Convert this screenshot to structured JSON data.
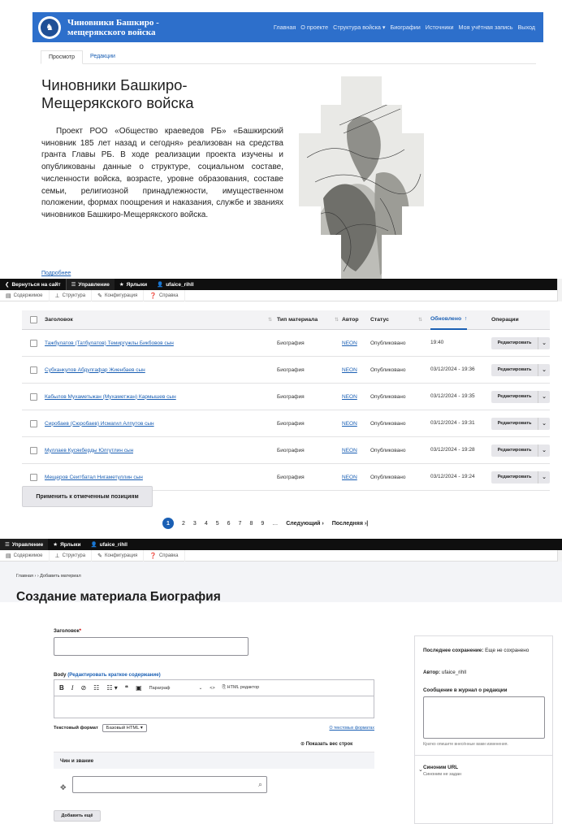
{
  "site": {
    "name": "Чиновники Башкиро - мещерякского войска",
    "nav": [
      "Главная",
      "О проекте",
      "Структура войска ▾",
      "Биографии",
      "Источники",
      "Моя учётная запись",
      "Выход"
    ],
    "tabs": {
      "view": "Просмотр",
      "edit": "Редакции"
    },
    "title": "Чиновники Башкиро-Мещерякского войска",
    "intro": "Проект РОО «Общество краеведов РБ» «Башкирский чиновник 185 лет назад и сегодня» реализован на средства гранта Главы РБ. В ходе реализации проекта изучены и опубликованы данные о структуре, социальном составе, численности войска, возрасте, уровне образования, составе семьи, религиозной принадлежности, имущественном положении, формах поощрения и наказания, службе и званиях чиновников Башкиро-Мещерякского войска.",
    "more": "Подробнее"
  },
  "admin_toolbar": {
    "back": "Вернуться на сайт",
    "manage": "Управление",
    "shortcuts": "Ярлыки",
    "user": "ufaice_rihll"
  },
  "admin_subbar": [
    "Содержимое",
    "Структура",
    "Конфигурация",
    "Справка"
  ],
  "content_table": {
    "headers": {
      "title": "Заголовок",
      "type": "Тип материала",
      "author": "Автор",
      "status": "Статус",
      "updated": "Обновлено",
      "ops": "Операции"
    },
    "rows": [
      {
        "title": "Тажбулатов (Татбулатов) Темиргужлы Бикбовов сын",
        "type": "Биография",
        "author": "NEON",
        "status": "Опубликовано",
        "updated": "19:40"
      },
      {
        "title": "Субханкулов Абдулгафар Жиенбаев сын",
        "type": "Биография",
        "author": "NEON",
        "status": "Опубликовано",
        "updated": "03/12/2024 - 19:36"
      },
      {
        "title": "Кабылов Мухаметьжан (Мухаметжан) Кармышев сын",
        "type": "Биография",
        "author": "NEON",
        "status": "Опубликовано",
        "updated": "03/12/2024 - 19:35"
      },
      {
        "title": "Сиробаев (Сюробаев) Исмагил Алпутов сын",
        "type": "Биография",
        "author": "NEON",
        "status": "Опубликовано",
        "updated": "03/12/2024 - 19:31"
      },
      {
        "title": "Муллаев Кусякберды Юлгутлин сын",
        "type": "Биография",
        "author": "NEON",
        "status": "Опубликовано",
        "updated": "03/12/2024 - 19:28"
      },
      {
        "title": "Мещеров Сеитбатал Нигаметуллин сын",
        "type": "Биография",
        "author": "NEON",
        "status": "Опубликовано",
        "updated": "03/12/2024 - 19:24"
      }
    ],
    "op_label": "Редактировать",
    "apply": "Применить к отмеченным позициям"
  },
  "pager": {
    "current": "1",
    "pages": [
      "2",
      "3",
      "4",
      "5",
      "6",
      "7",
      "8",
      "9"
    ],
    "ellipsis": "…",
    "next": "Следующий ›",
    "last": "Последняя ›|"
  },
  "create_form": {
    "crumb": "Главная  ›  › Добавить материал",
    "title": "Создание материала Биография",
    "label_title": "Заголовок",
    "req": "*",
    "label_body": "Body",
    "body_summary": "(Редактировать краткое содержание)",
    "editor": {
      "bold": "B",
      "italic": "I",
      "link": "⊘",
      "ul": "☷",
      "ol": "☷ ▾",
      "quote": "❝",
      "image": "▣",
      "paragraph": "Параграф",
      "code": "<>",
      "source": "HTML редактор"
    },
    "format_label": "Текстовый формат",
    "format_value": "Базовый HTML ▾",
    "format_link": "О текстовых форматах",
    "show_weights": "Показать вес строк",
    "rank_group": "Чин и звание",
    "add_more": "Добавить ещё"
  },
  "side_panel": {
    "last_saved_label": "Последнее сохранение:",
    "last_saved_value": "Еще не сохранено",
    "author_label": "Автор:",
    "author_value": "ufaice_rihll",
    "revision_label": "Сообщение в журнал о редакции",
    "revision_hint": "Кратко опишите внесённые вами изменения.",
    "url_label": "Синоним URL",
    "url_value": "Синоним не задан"
  }
}
